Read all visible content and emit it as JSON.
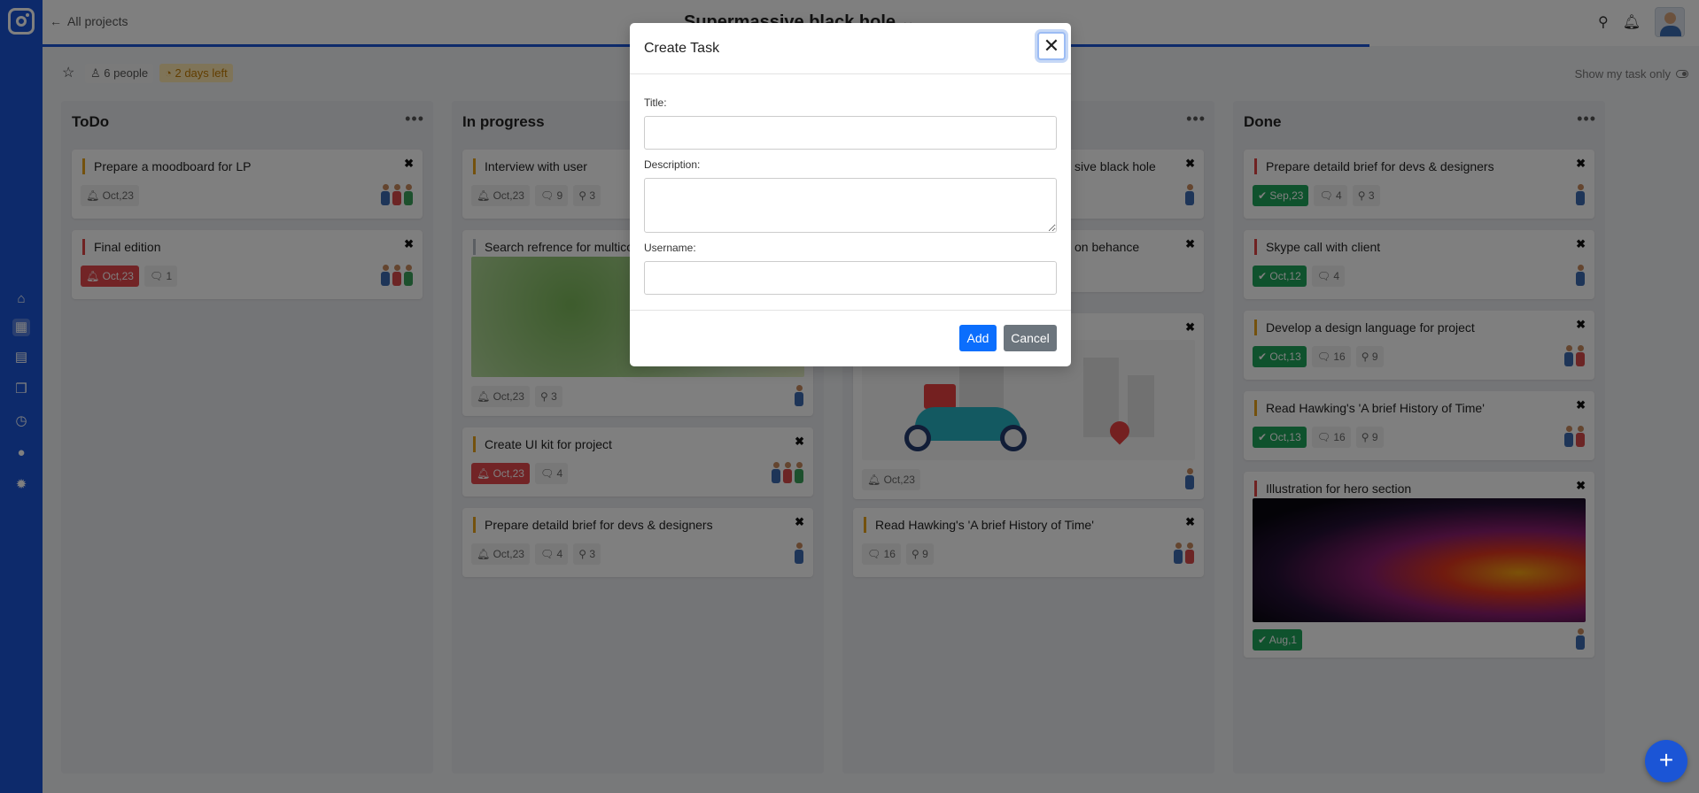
{
  "header": {
    "back_label": "All projects",
    "project_title": "Supermassive black hole",
    "people": "6 people",
    "days_left": "2 days left",
    "show_my_task": "Show my task only"
  },
  "sidebar": {
    "items": [
      "home-icon",
      "board-icon",
      "calendar-icon",
      "book-icon",
      "clock-icon",
      "user-icon",
      "gear-icon"
    ],
    "active": "board-icon"
  },
  "columns": [
    {
      "title": "ToDo",
      "cards": [
        {
          "title": "Prepare a moodboard for LP",
          "chips": [
            "Oct,23"
          ]
        },
        {
          "title": "Final edition",
          "chips": [
            "Oct,23",
            "1"
          ]
        }
      ]
    },
    {
      "title": "In progress",
      "cards": [
        {
          "title": "Interview with user",
          "chips": [
            "Oct,23",
            "9",
            "3"
          ]
        },
        {
          "title": "Search refrence for multicol",
          "chips": [
            "Oct,23",
            "3"
          ]
        },
        {
          "title": "Create UI kit for project",
          "chips": [
            "Oct,23",
            "4"
          ]
        },
        {
          "title": "Prepare detaild brief for devs & designers",
          "chips": [
            "Oct,23",
            "4",
            "3"
          ]
        }
      ]
    },
    {
      "title": "",
      "cards": [
        {
          "title": "sive black hole",
          "chips": []
        },
        {
          "title": "on behance",
          "chips": []
        },
        {
          "title": "",
          "chips": [
            "Oct,23"
          ]
        },
        {
          "title": "Read Hawking's 'A brief History of Time'",
          "chips": [
            "16",
            "9"
          ]
        }
      ]
    },
    {
      "title": "Done",
      "cards": [
        {
          "title": "Prepare detaild brief for devs & designers",
          "chips": [
            "Sep,23",
            "4",
            "3"
          ]
        },
        {
          "title": "Skype call with client",
          "chips": [
            "Oct,12",
            "4"
          ]
        },
        {
          "title": "Develop a design language for project",
          "chips": [
            "Oct,13",
            "16",
            "9"
          ]
        },
        {
          "title": "Read Hawking's 'A brief History of Time'",
          "chips": [
            "Oct,13",
            "16",
            "9"
          ]
        },
        {
          "title": "Illustration for hero section",
          "chips": [
            "Aug,1"
          ]
        }
      ]
    }
  ],
  "modal": {
    "title": "Create Task",
    "close_icon": "close-icon",
    "title_label": "Title:",
    "title_value": "",
    "description_label": "Description:",
    "description_value": "",
    "username_label": "Username:",
    "username_value": "",
    "add_label": "Add",
    "cancel_label": "Cancel"
  },
  "colors": {
    "brand": "#1b55d6",
    "primary_button": "#0b6efd",
    "secondary_button": "#6c757d",
    "danger": "#e5484d",
    "success": "#1fa55a",
    "warning": "#e8a21a"
  },
  "fab_label": "+"
}
